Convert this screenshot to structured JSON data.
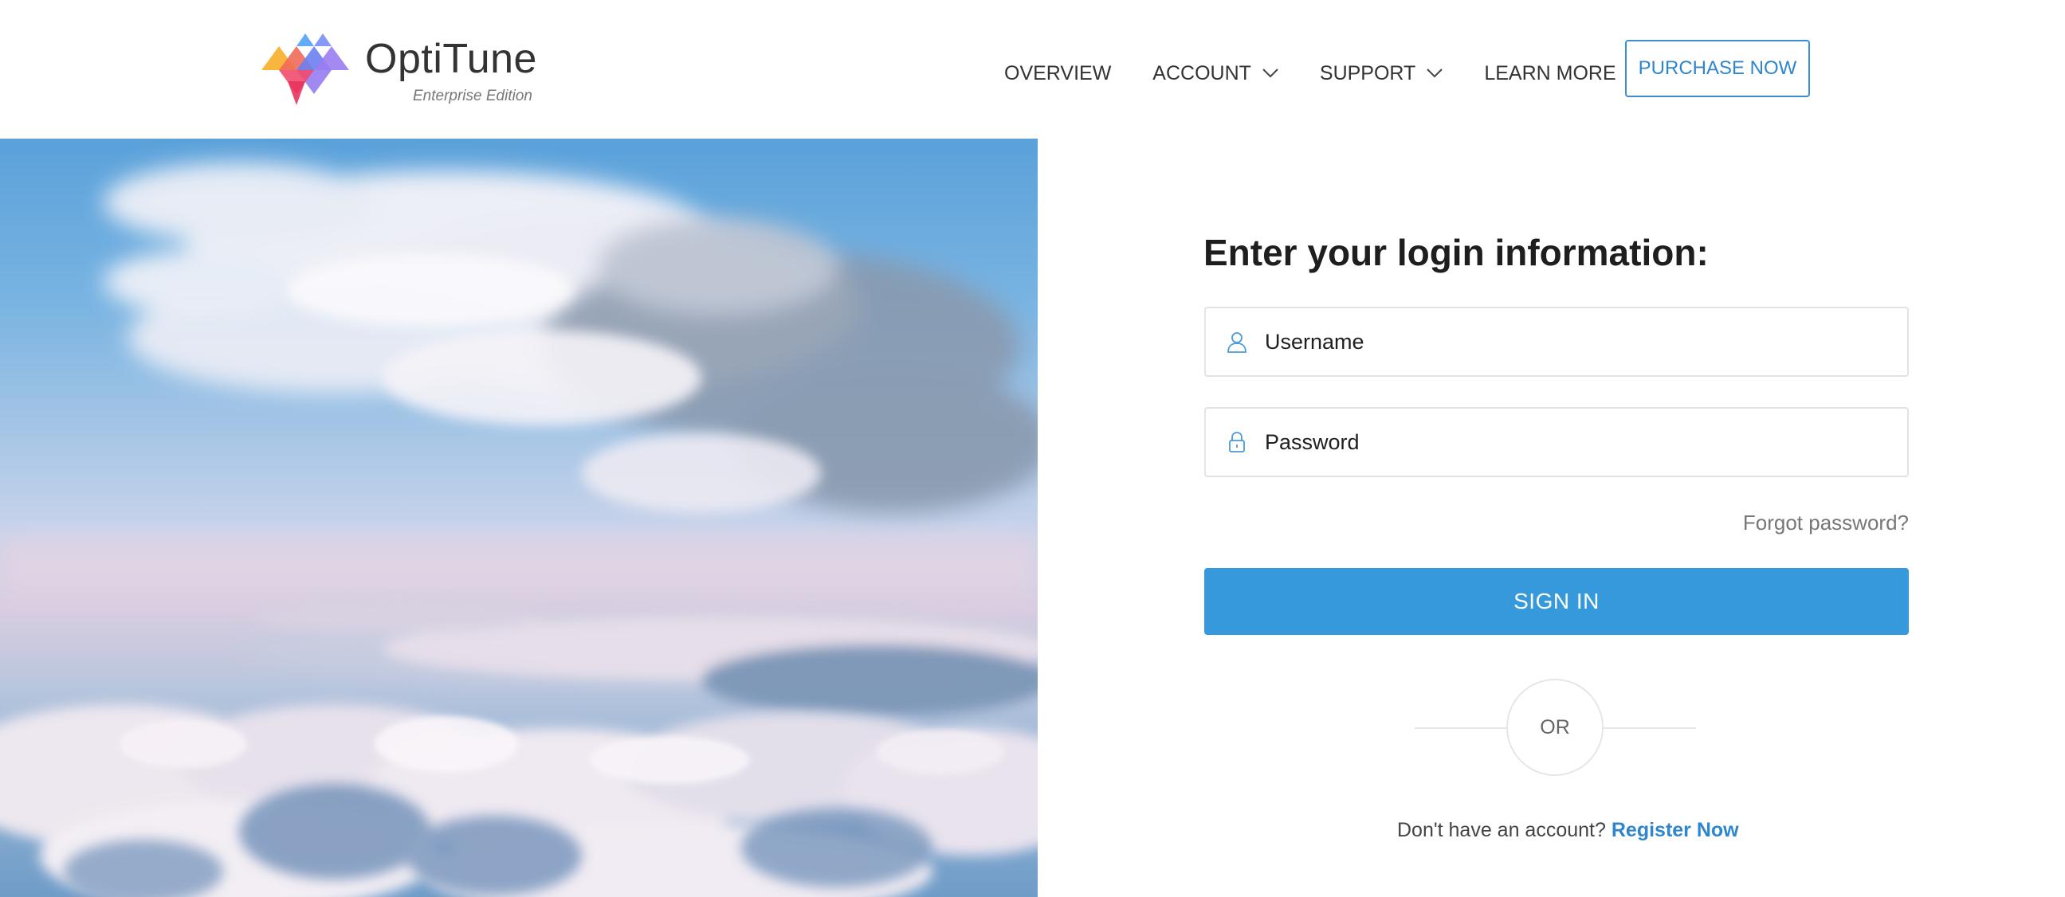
{
  "brand": {
    "name": "OptiTune",
    "edition": "Enterprise Edition"
  },
  "nav": {
    "items": [
      {
        "label": "OVERVIEW",
        "dropdown": false
      },
      {
        "label": "ACCOUNT",
        "dropdown": true
      },
      {
        "label": "SUPPORT",
        "dropdown": true
      },
      {
        "label": "LEARN MORE",
        "dropdown": false
      }
    ],
    "purchase_label": "PURCHASE NOW"
  },
  "hero": {
    "icon": "sky-clouds-image"
  },
  "login": {
    "title": "Enter your login information:",
    "username_placeholder": "Username",
    "password_placeholder": "Password",
    "forgot_label": "Forgot password?",
    "signin_label": "SIGN IN",
    "or_label": "OR",
    "register_prompt": "Don't have an account?",
    "register_link": "Register Now"
  },
  "colors": {
    "accent": "#3699dc",
    "link": "#2f86cd",
    "text": "#222222",
    "muted": "#777777"
  }
}
